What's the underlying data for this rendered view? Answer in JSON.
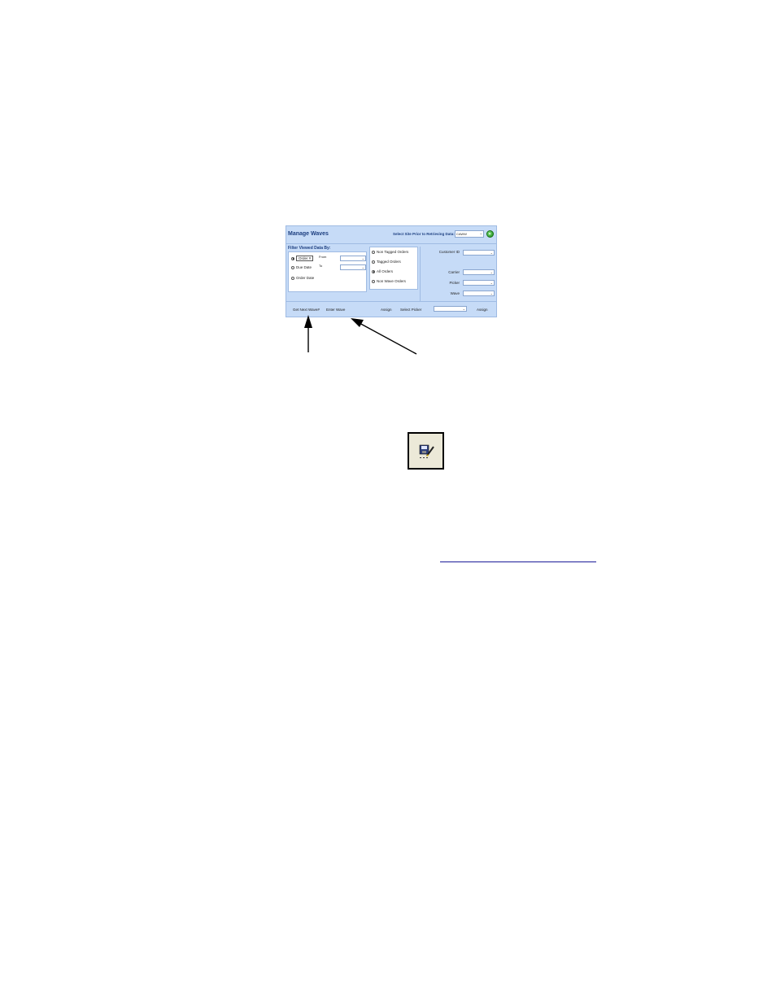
{
  "panel": {
    "title": "Manage Waves",
    "site_label": "Select Site Prior to Retrieving Data:",
    "site_value": "CAWW",
    "filter_heading": "Filter Viewed Data By:",
    "left_options": [
      "Order #",
      "Due Date",
      "Order Date"
    ],
    "from_label": "From",
    "to_label": "To",
    "mid_options": [
      "Non Tagged Orders",
      "Tagged Orders",
      "All Orders",
      "Non Wave Orders"
    ],
    "right_fields": [
      "Customer ID",
      "Carrier",
      "Picker",
      "Wave"
    ],
    "bottom": {
      "get_next_wave": "Get Next Wave#",
      "enter_wave": "Enter Wave",
      "assign_1": "Assign",
      "select_picker": "Select Picker",
      "assign_2": "Assign"
    }
  },
  "icons": {
    "go": "go-button-icon",
    "save_edit": "save-edit-icon"
  }
}
